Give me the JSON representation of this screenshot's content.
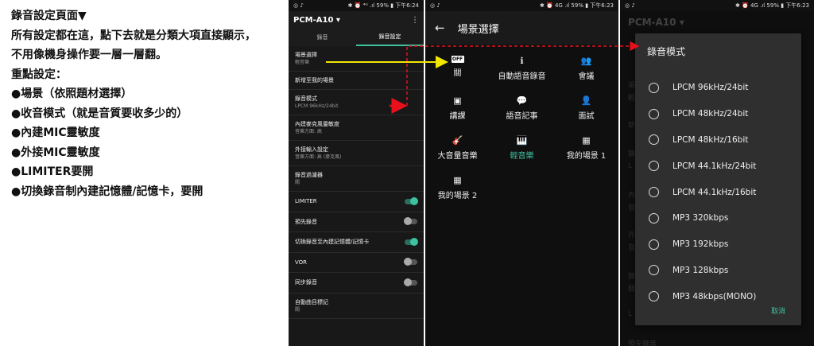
{
  "notes": {
    "title": "錄音設定頁面▼",
    "lines": [
      "所有設定都在這，點下去就是分類大項直接顯示，",
      "不用像機身操作要一層一層翻。",
      "重點設定：",
      "●場景（依照題材選擇）",
      "●收音模式（就是音質要收多少的）",
      "●內建MIC靈敏度",
      "●外接MIC靈敏度",
      "●LIMITER要開",
      "●切換錄音制內建記憶體/記憶卡，要開"
    ]
  },
  "colors": {
    "accent": "#3ec1a0",
    "arrow_yellow": "#f2e600",
    "arrow_red": "#e8101a"
  },
  "screen1": {
    "status": {
      "left": "◎ ♪",
      "right": "✱ ⏰ ⁴ᴳ .ıl 59% ▮ 下午6:24"
    },
    "app_title": "PCM-A10 ▾",
    "menu_icon": "⋮",
    "tabs": [
      "錄音",
      "錄音設定"
    ],
    "settings": [
      {
        "title": "場景選擇",
        "sub": "輕音樂"
      },
      {
        "title": "新增至我的場景",
        "sub": ""
      },
      {
        "title": "錄音模式",
        "sub": "LPCM 96kHz/24bit"
      },
      {
        "title": "內建麥克風靈敏度",
        "sub": "音樂方面: 高"
      },
      {
        "title": "外接輸入設定",
        "sub": "音樂方面: 高 (麥克風)"
      },
      {
        "title": "錄音過濾器",
        "sub": "關"
      }
    ],
    "toggles": [
      {
        "label": "LIMITER",
        "on": true
      },
      {
        "label": "預先錄音",
        "on": false
      },
      {
        "label": "切換錄音至內建記憶體/記憶卡",
        "on": true
      },
      {
        "label": "VOR",
        "on": false
      },
      {
        "label": "同步錄音",
        "on": false
      }
    ],
    "last": {
      "title": "自動曲目標記",
      "sub": "關"
    }
  },
  "screen2": {
    "status": {
      "left": "◎ ♪",
      "right": "✱ ⏰ 4G .ıl 59% ▮ 下午6:23"
    },
    "title": "場景選擇",
    "back_icon": "←",
    "scenes": [
      {
        "label": "關",
        "icon": "OFF",
        "icon_name": "off-badge-icon",
        "selected": false
      },
      {
        "label": "自動語音錄音",
        "icon": "ℹ",
        "icon_name": "auto-voice-icon",
        "selected": false
      },
      {
        "label": "會議",
        "icon": "👥",
        "icon_name": "meeting-icon",
        "selected": false
      },
      {
        "label": "講課",
        "icon": "▣",
        "icon_name": "lecture-icon",
        "selected": false
      },
      {
        "label": "語音記事",
        "icon": "💬",
        "icon_name": "voice-memo-icon",
        "selected": false
      },
      {
        "label": "面試",
        "icon": "👤",
        "icon_name": "interview-icon",
        "selected": false
      },
      {
        "label": "大音量音樂",
        "icon": "🎸",
        "icon_name": "guitar-icon",
        "selected": false
      },
      {
        "label": "輕音樂",
        "icon": "🎹",
        "icon_name": "piano-icon",
        "selected": true
      },
      {
        "label": "我的場景 1",
        "icon": "▦",
        "icon_name": "my-scene-icon",
        "selected": false
      },
      {
        "label": "我的場景 2",
        "icon": "▦",
        "icon_name": "my-scene-icon",
        "selected": false
      }
    ]
  },
  "screen3": {
    "status": {
      "left": "◎ ♪",
      "right": "✱ ⏰ 4G .ıl 59% ▮ 下午6:23"
    },
    "app_title": "PCM-A10 ▾",
    "background_fragments": [
      "場",
      "輕",
      "新",
      "錄",
      "L",
      "內",
      "音",
      "外",
      "音",
      "錄",
      "關",
      "L",
      "預先錄音"
    ],
    "dialog_title": "錄音模式",
    "options": [
      "LPCM 96kHz/24bit",
      "LPCM 48kHz/24bit",
      "LPCM 48kHz/16bit",
      "LPCM 44.1kHz/24bit",
      "LPCM 44.1kHz/16bit",
      "MP3 320kbps",
      "MP3 192kbps",
      "MP3 128kbps",
      "MP3 48kbps(MONO)"
    ],
    "cancel_label": "取消"
  }
}
